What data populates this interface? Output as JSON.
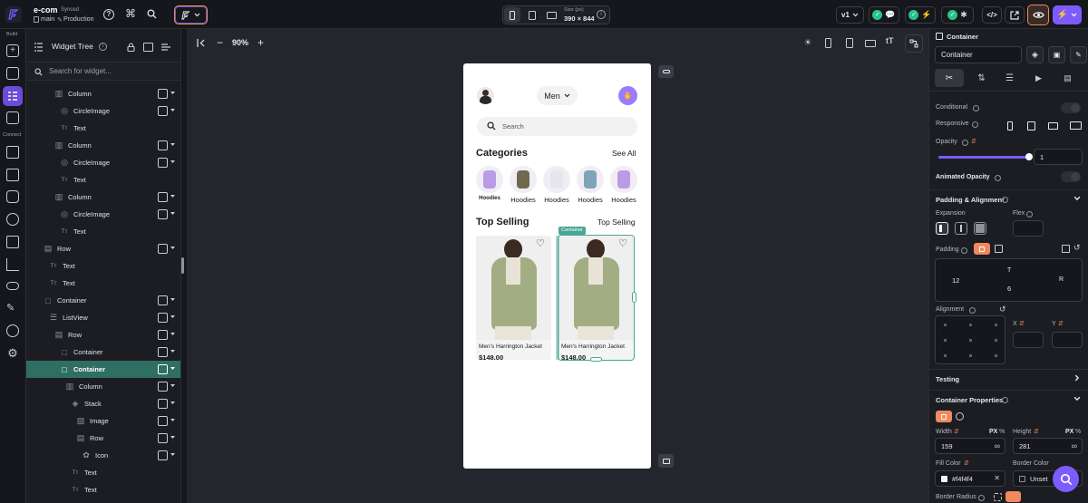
{
  "project": {
    "name": "e-com",
    "status": "Synced",
    "branch": "main",
    "env": "Production"
  },
  "device": {
    "size_label": "Size (px)",
    "size_value": "390 × 844"
  },
  "version": "v1",
  "rail": {
    "build": "Build",
    "connect": "Connect"
  },
  "tree": {
    "title": "Widget Tree",
    "search_placeholder": "Search for widget...",
    "items": [
      {
        "label": "Column",
        "icon": "column-icon",
        "indent": 31
      },
      {
        "label": "CircleImage",
        "icon": "circle-image-icon",
        "indent": 37
      },
      {
        "label": "Text",
        "icon": "text-icon",
        "indent": 37
      },
      {
        "label": "Column",
        "icon": "column-icon",
        "indent": 31
      },
      {
        "label": "CircleImage",
        "icon": "circle-image-icon",
        "indent": 37
      },
      {
        "label": "Text",
        "icon": "text-icon",
        "indent": 37
      },
      {
        "label": "Column",
        "icon": "column-icon",
        "indent": 31
      },
      {
        "label": "CircleImage",
        "icon": "circle-image-icon",
        "indent": 37
      },
      {
        "label": "Text",
        "icon": "text-icon",
        "indent": 37
      },
      {
        "label": "Row",
        "icon": "row-icon",
        "indent": 19
      },
      {
        "label": "Text",
        "icon": "text-icon",
        "indent": 25
      },
      {
        "label": "Text",
        "icon": "text-icon",
        "indent": 25
      },
      {
        "label": "Container",
        "icon": "container-icon",
        "indent": 19
      },
      {
        "label": "ListView",
        "icon": "listview-icon",
        "indent": 25
      },
      {
        "label": "Row",
        "icon": "row-icon",
        "indent": 31
      },
      {
        "label": "Container",
        "icon": "container-icon",
        "indent": 37
      },
      {
        "label": "Container",
        "icon": "container-icon",
        "indent": 37,
        "selected": true
      },
      {
        "label": "Column",
        "icon": "column-icon",
        "indent": 43
      },
      {
        "label": "Stack",
        "icon": "stack-icon",
        "indent": 49
      },
      {
        "label": "Image",
        "icon": "image-icon",
        "indent": 55
      },
      {
        "label": "Row",
        "icon": "row-icon",
        "indent": 55
      },
      {
        "label": "Icon",
        "icon": "icon-icon",
        "indent": 61
      },
      {
        "label": "Text",
        "icon": "text-icon",
        "indent": 49
      },
      {
        "label": "Text",
        "icon": "text-icon",
        "indent": 49
      }
    ]
  },
  "zoom": "90%",
  "phone": {
    "dropdown": "Men",
    "search_placeholder": "Search",
    "categories_title": "Categories",
    "see_all": "See All",
    "categories": [
      "Hoodies",
      "Hoodies",
      "Hoodies",
      "Hoodies",
      "Hoodies"
    ],
    "top_selling_title": "Top Selling",
    "top_selling_link": "Top Selling",
    "products": [
      {
        "name": "Men's  Harrington Jacket",
        "price": "$148.00"
      },
      {
        "name": "Men's  Harrington Jacket",
        "price": "$148.00"
      }
    ],
    "selected_tag": "Container"
  },
  "props": {
    "header": "Container",
    "name_value": "Container",
    "conditional": "Conditional",
    "responsive": "Responsive",
    "opacity_label": "Opacity",
    "opacity_value": "1",
    "opacity_level": 1,
    "animated_opacity": "Animated Opacity",
    "padding_section": "Padding & Alignment",
    "expansion": "Expansion",
    "flex": "Flex",
    "padding": "Padding",
    "pad_left": "12",
    "pad_top": "T",
    "pad_right": "R",
    "pad_bottom": "6",
    "alignment": "Alignment",
    "align_x": "X",
    "align_y": "Y",
    "testing": "Testing",
    "container_props": "Container Properties",
    "width_label": "Width",
    "width_value": "159",
    "width_unit": "PX",
    "height_label": "Height",
    "height_value": "281",
    "height_unit": "PX",
    "percent": "%",
    "fill_label": "Fill Color",
    "fill_value": "#f4f4f4",
    "border_label": "Border Color",
    "border_value": "Unset",
    "radius_label": "Border Radius"
  },
  "colors": {
    "accent": "#7c5cff",
    "selected": "#2f6f63",
    "teal": "#4aa696",
    "orange": "#f08a5d",
    "purple_btn": "#7c5cff",
    "avatar_btn": "#9b7bff",
    "green_check": "#27c48a"
  }
}
